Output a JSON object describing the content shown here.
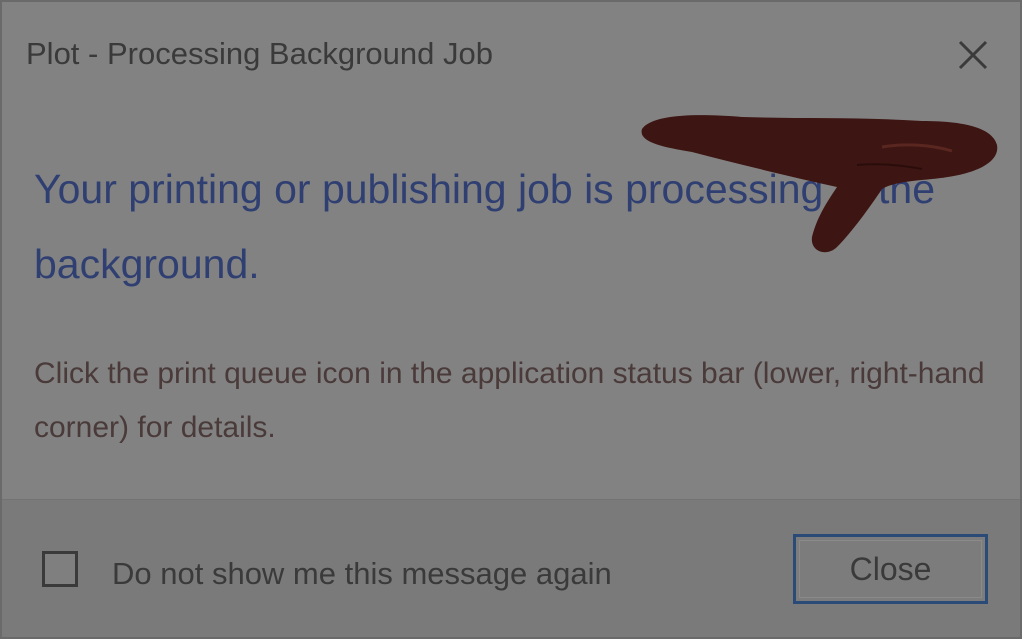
{
  "dialog": {
    "title": "Plot - Processing Background Job",
    "main_instruction": "Your printing or publishing job is processing in the background.",
    "body": "Click the print queue icon in the application status bar (lower, right-hand corner) for details."
  },
  "footer": {
    "checkbox_checked": false,
    "checkbox_label": "Do not show me this message again",
    "close_label": "Close"
  },
  "icons": {
    "title_close": "close-icon",
    "overlay": "pointing-hand-icon"
  },
  "colors": {
    "instruction_text": "#2f3f72",
    "button_focus_border": "#2a4a78",
    "hand": "#3d1512"
  }
}
